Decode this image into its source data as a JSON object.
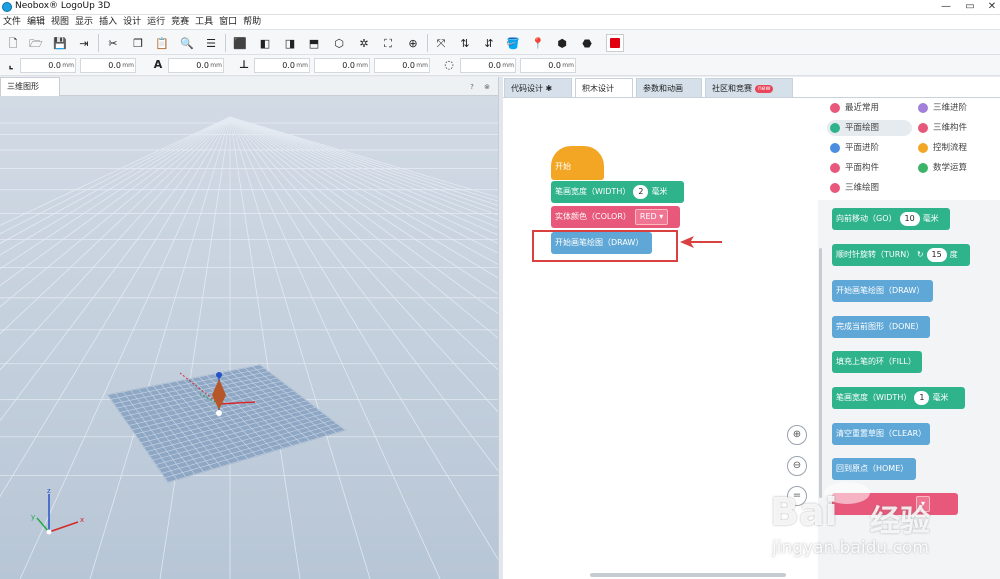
{
  "window": {
    "title": "Neobox® LogoUp 3D"
  },
  "menu": [
    "文件",
    "编辑",
    "视图",
    "显示",
    "插入",
    "设计",
    "运行",
    "竞赛",
    "工具",
    "窗口",
    "帮助"
  ],
  "transform_fields": [
    {
      "value": "0.0",
      "unit": "mm"
    },
    {
      "value": "0.0",
      "unit": "mm"
    },
    {
      "value": "0.0",
      "unit": "mm"
    },
    {
      "value": "0.0",
      "unit": "mm"
    },
    {
      "value": "0.0",
      "unit": "mm"
    },
    {
      "value": "0.0",
      "unit": "mm"
    },
    {
      "value": "0.0",
      "unit": "mm"
    },
    {
      "value": "0.0",
      "unit": "mm"
    }
  ],
  "left_panel": {
    "tab": "三维图形",
    "help": "?",
    "close": "⊗"
  },
  "right_tabs": [
    "代码设计 ✱",
    "积木设计",
    "参数和动画",
    "社区和竞赛"
  ],
  "new_badge": "new",
  "workspace": {
    "hat": "开始",
    "width_block": {
      "label": "笔画宽度（WIDTH）",
      "value": "2",
      "unit": "毫米"
    },
    "color_block": {
      "label": "实体颜色（COLOR）",
      "value": "RED"
    },
    "draw_block": {
      "label": "开始画笔绘图（DRAW）"
    }
  },
  "categories": [
    {
      "label": "最近常用",
      "color": "#e8587a"
    },
    {
      "label": "三维进阶",
      "color": "#a27fd8"
    },
    {
      "label": "平面绘图",
      "color": "#2fb38a"
    },
    {
      "label": "三维构件",
      "color": "#e8587a"
    },
    {
      "label": "平面进阶",
      "color": "#4b8ee0"
    },
    {
      "label": "控制流程",
      "color": "#f2a623"
    },
    {
      "label": "平面构件",
      "color": "#e8587a"
    },
    {
      "label": "数学运算",
      "color": "#3db36a"
    },
    {
      "label": "三维绘图",
      "color": "#e8587a"
    }
  ],
  "flyout": {
    "go": {
      "label": "向前移动（GO）",
      "value": "10",
      "unit": "毫米"
    },
    "turn": {
      "label": "顺时针旋转（TURN）",
      "value": "15",
      "unit": "度"
    },
    "draw": "开始画笔绘图（DRAW）",
    "done": "完成当前图形（DONE）",
    "fill": "填充上笔的环（FILL）",
    "width": {
      "label": "笔画宽度（WIDTH）",
      "value": "1",
      "unit": "毫米"
    },
    "clear": "清空重置草图（CLEAR）",
    "home": "回到原点（HOME）"
  },
  "axes": {
    "x": "x",
    "y": "y",
    "z": "z"
  },
  "watermark": {
    "brand": "Bai",
    "brand2": "经验",
    "url": "jingyan.baidu.com"
  }
}
